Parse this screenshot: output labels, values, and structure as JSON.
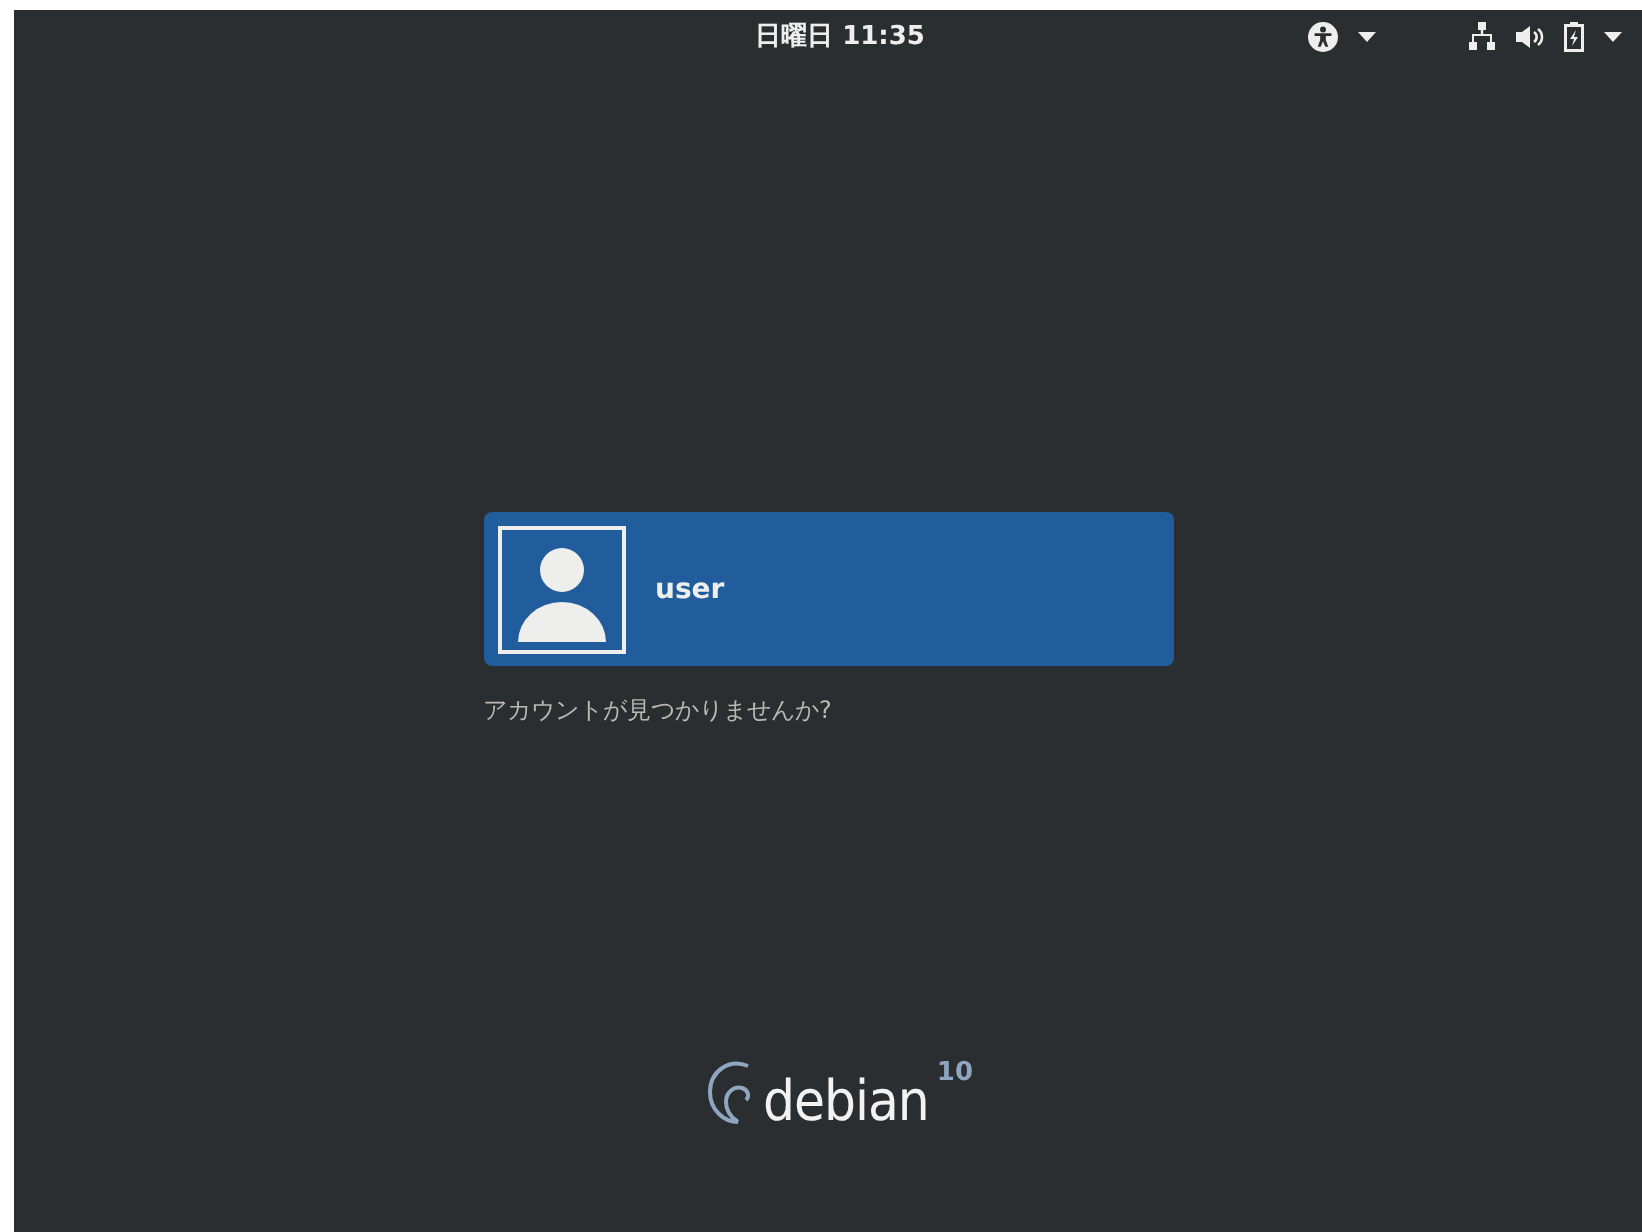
{
  "top_bar": {
    "clock": "日曜日 11:35"
  },
  "users": [
    {
      "name": "user",
      "selected": true
    }
  ],
  "not_listed_link": "アカウントが見つかりませんか?",
  "logo": {
    "name": "debian",
    "version": "10"
  }
}
